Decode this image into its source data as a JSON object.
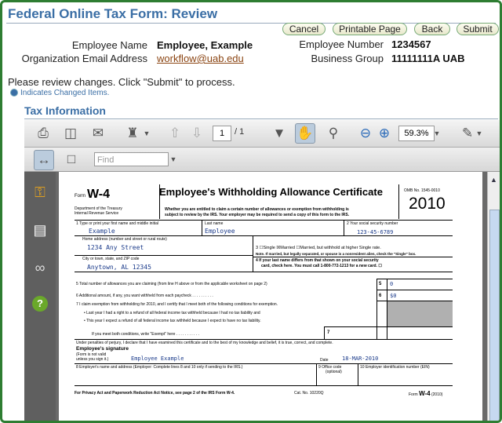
{
  "title": "Federal Online Tax Form: Review",
  "buttons": {
    "cancel": "Cancel",
    "printable": "Printable Page",
    "back": "Back",
    "submit": "Submit"
  },
  "info": {
    "employee_name_label": "Employee Name",
    "employee_name": "Employee, Example",
    "org_email_label": "Organization Email Address",
    "org_email": "workflow@uab.edu",
    "employee_number_label": "Employee Number",
    "employee_number": "1234567",
    "business_group_label": "Business Group",
    "business_group": "11111111A UAB"
  },
  "message": "Please review changes. Click \"Submit\" to process.",
  "legend": "Indicates Changed Items.",
  "section_title": "Tax Information",
  "viewer": {
    "page_current": "1",
    "page_total": "/ 1",
    "zoom": "59.3%",
    "find_placeholder": "Find"
  },
  "form": {
    "form_label": "Form",
    "form_name": "W-4",
    "heading": "Employee's Withholding Allowance Certificate",
    "omb": "OMB No. 1545-0010",
    "year": "2010",
    "dept": "Department of the Treasury",
    "irs": "Internal Revenue Service",
    "notice1": "Whether you are entitled to claim a certain number of allowances or exemption from withholding is",
    "notice2": "subject to review by the IRS. Your employer may be required to send a copy of this form to the IRS.",
    "f1_label": "1   Type or print your first name and middle initial",
    "first_name": "Example",
    "last_label": "Last name",
    "last_name": "Employee",
    "f2_label": "2     Your social security number",
    "ssn": "123-45-6789",
    "addr_label": "Home address (number and street or rural route)",
    "address": "1234 Any Street",
    "f3_single": "Single",
    "f3_married": "Married",
    "f3_higher": "Married, but withhold at higher Single rate.",
    "f3_note": "Note. If married, but legally separated, or spouse is a nonresident alien, check the \"Single\" box.",
    "city_label": "City or town, state, and ZIP code",
    "city": "Anytown, AL 12345",
    "f4_label1": "4   If your last name differs from that shown on your social security",
    "f4_label2": "card, check here. You must call 1-800-772-1213 for a new card.",
    "line5": "5   Total number of allowances you are claiming (from line H above or from the applicable worksheet on page 2)",
    "line5_num": "5",
    "line5_val": "0",
    "line6": "6   Additional amount, if any, you want withheld from each paycheck . . . . . . . . . .",
    "line6_num": "6",
    "line6_val": "$0",
    "line7": "7   I claim exemption from withholding for 2010, and I certify that I meet both of the following conditions for exemption.",
    "line7_b1": "•  Last year I had a right to a refund of all federal income tax withheld because I had no tax liability and",
    "line7_b2": "•  This year I expect a refund of all federal income tax withheld because I expect to have no tax liability.",
    "line7_exempt": "If you meet both conditions, write \"Exempt\" here . . . . . . . . . . .",
    "line7_num": "7",
    "perjury": "Under penalties of perjury, I declare that I have examined this certificate and to the best of my knowledge and belief, it is true, correct, and complete.",
    "sig_label": "Employee's signature",
    "sig_note1": "(Form is not valid",
    "sig_note2": "unless you sign it.)",
    "signature": "Employee Example",
    "date_label": "Date",
    "date": "18-MAR-2010",
    "line8": "8   Employer's name and address (Employer: Complete lines 8 and 10 only if sending to the IRS.)",
    "line9": "9   Office code",
    "line9b": "(optional)",
    "line10": "10   Employer identification number (EIN)",
    "footer": "For Privacy Act and Paperwork Reduction Act Notice, see page 2 of the IRS Form W-4.",
    "cat": "Cat. No. 10220Q",
    "footer_form": "Form",
    "footer_w4": "W-4",
    "footer_year": "(2010)"
  },
  "colors": {
    "accent": "#3a6ea5",
    "frame": "#2e7d32",
    "link": "#8b4513",
    "handwriting": "#1a3a8a"
  },
  "icons": [
    "print-icon",
    "save-icon",
    "email-icon",
    "stamp-icon",
    "prev-page-icon",
    "next-page-icon",
    "select-tool-icon",
    "hand-tool-icon",
    "zoom-tool-icon",
    "zoom-out-icon",
    "zoom-in-icon",
    "sign-icon",
    "fit-width-icon",
    "fit-page-icon",
    "lock-icon",
    "pages-icon",
    "binoculars-icon",
    "help-icon"
  ]
}
